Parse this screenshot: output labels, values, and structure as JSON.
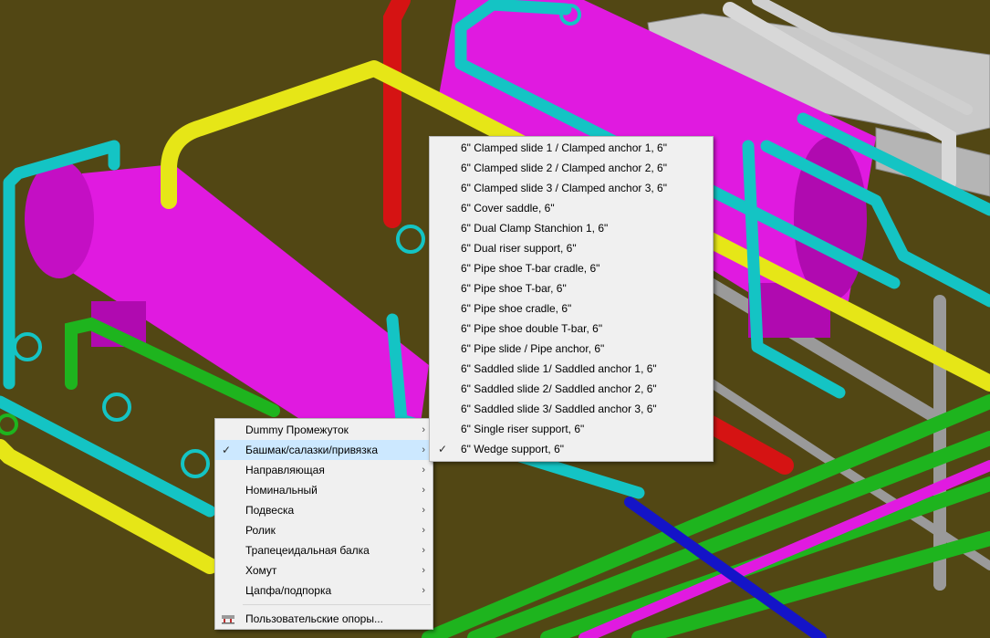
{
  "context_menu": {
    "items": [
      {
        "label": "Dummy Промежуток",
        "checked": false,
        "has_submenu": true
      },
      {
        "label": "Башмак/салазки/привязка",
        "checked": true,
        "has_submenu": true,
        "highlighted": true
      },
      {
        "label": "Направляющая",
        "checked": false,
        "has_submenu": true
      },
      {
        "label": "Номинальный",
        "checked": false,
        "has_submenu": true
      },
      {
        "label": "Подвеска",
        "checked": false,
        "has_submenu": true
      },
      {
        "label": "Ролик",
        "checked": false,
        "has_submenu": true
      },
      {
        "label": "Трапецеидальная балка",
        "checked": false,
        "has_submenu": true
      },
      {
        "label": "Хомут",
        "checked": false,
        "has_submenu": true
      },
      {
        "label": "Цапфа/подпорка",
        "checked": false,
        "has_submenu": true
      }
    ],
    "user_supports_label": "Пользовательские опоры..."
  },
  "submenu": {
    "items": [
      {
        "label": "6\" Clamped slide 1 / Clamped anchor 1, 6\"",
        "checked": false
      },
      {
        "label": "6\" Clamped slide 2 / Clamped anchor 2, 6\"",
        "checked": false
      },
      {
        "label": "6\" Clamped slide 3 / Clamped anchor 3, 6\"",
        "checked": false
      },
      {
        "label": "6\" Cover saddle, 6\"",
        "checked": false
      },
      {
        "label": "6\" Dual Clamp Stanchion 1, 6\"",
        "checked": false
      },
      {
        "label": "6\" Dual riser support, 6\"",
        "checked": false
      },
      {
        "label": "6\" Pipe shoe T-bar cradle, 6\"",
        "checked": false
      },
      {
        "label": "6\" Pipe shoe T-bar, 6\"",
        "checked": false
      },
      {
        "label": "6\" Pipe shoe cradle, 6\"",
        "checked": false
      },
      {
        "label": "6\" Pipe shoe double T-bar, 6\"",
        "checked": false
      },
      {
        "label": "6\" Pipe slide / Pipe anchor, 6\"",
        "checked": false
      },
      {
        "label": "6\" Saddled slide 1/ Saddled anchor 1, 6\"",
        "checked": false
      },
      {
        "label": "6\" Saddled slide 2/ Saddled anchor 2, 6\"",
        "checked": false
      },
      {
        "label": "6\" Saddled slide 3/ Saddled anchor 3, 6\"",
        "checked": false
      },
      {
        "label": "6\" Single riser support, 6\"",
        "checked": false
      },
      {
        "label": "6\" Wedge support, 6\"",
        "checked": true
      }
    ]
  },
  "glyphs": {
    "check": "✓",
    "submenu_arrow": "›"
  },
  "colors": {
    "viewport_background": "#524714",
    "vessel": "#e01ae0",
    "pipe_cyan": "#14c4c4",
    "pipe_yellow": "#e6e617",
    "pipe_green": "#1eb41e",
    "pipe_red": "#d51313",
    "pipe_blue": "#1414c8",
    "structure_gray": "#bdbdbd",
    "menu_background": "#f0f0f0",
    "menu_highlight": "#cce8ff"
  }
}
